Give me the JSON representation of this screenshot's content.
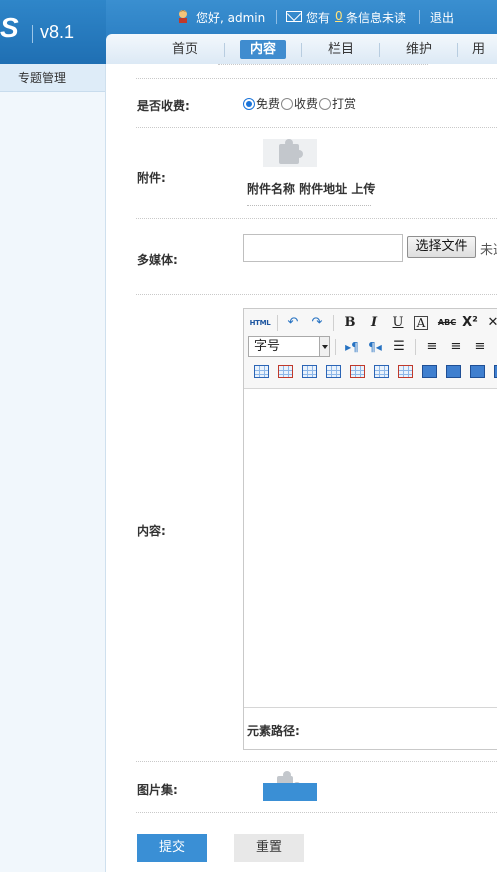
{
  "logo": {
    "mark": "S",
    "version": "v8.1"
  },
  "userbar": {
    "greeting": "您好, admin",
    "messages_prefix": "您有",
    "messages_count": "0",
    "messages_suffix": "条信息未读",
    "logout": "退出",
    "user_icon": "user-avatar-icon",
    "mail_icon": "envelope-icon"
  },
  "nav": {
    "items": [
      "首页",
      "内容",
      "栏目",
      "维护",
      "用"
    ],
    "active_index": 1,
    "active_color": "#3f8ccf"
  },
  "sidebar": {
    "items": [
      {
        "label": "专题管理"
      }
    ]
  },
  "form": {
    "charge": {
      "label": "是否收费:",
      "options": [
        "免费",
        "收费",
        "打赏"
      ],
      "selected": "免费"
    },
    "attachment": {
      "label": "附件:",
      "columns_text": "附件名称 附件地址 上传",
      "icon": "puzzle-plugin-icon"
    },
    "media": {
      "label": "多媒体:",
      "value": "",
      "file_button": "选择文件",
      "file_status": "未选"
    },
    "content": {
      "label": "内容:",
      "font_size_select": "字号",
      "path_label": "元素路径:",
      "toolbar_row1": [
        "source-html-icon",
        "undo-icon",
        "redo-icon",
        "bold-icon",
        "italic-icon",
        "underline-icon",
        "font-border-icon",
        "strikethrough-icon",
        "superscript-icon",
        "clear-format-icon"
      ],
      "toolbar_row2": [
        "ltr-icon",
        "rtl-icon",
        "indent-icon",
        "align-left-icon",
        "align-center-icon",
        "align-right-icon"
      ],
      "toolbar_row3": [
        "insert-table-icon",
        "delete-table-icon",
        "insert-caption-icon",
        "insert-row-icon",
        "delete-row-icon",
        "insert-col-icon",
        "delete-col-icon",
        "merge-cells-icon",
        "merge-right-icon",
        "merge-down-icon",
        "split-cells-icon"
      ]
    },
    "gallery": {
      "label": "图片集:"
    },
    "submit": "提交",
    "reset": "重置"
  },
  "colors": {
    "brand_blue": "#2477bd",
    "button_blue": "#3a8fd5"
  }
}
